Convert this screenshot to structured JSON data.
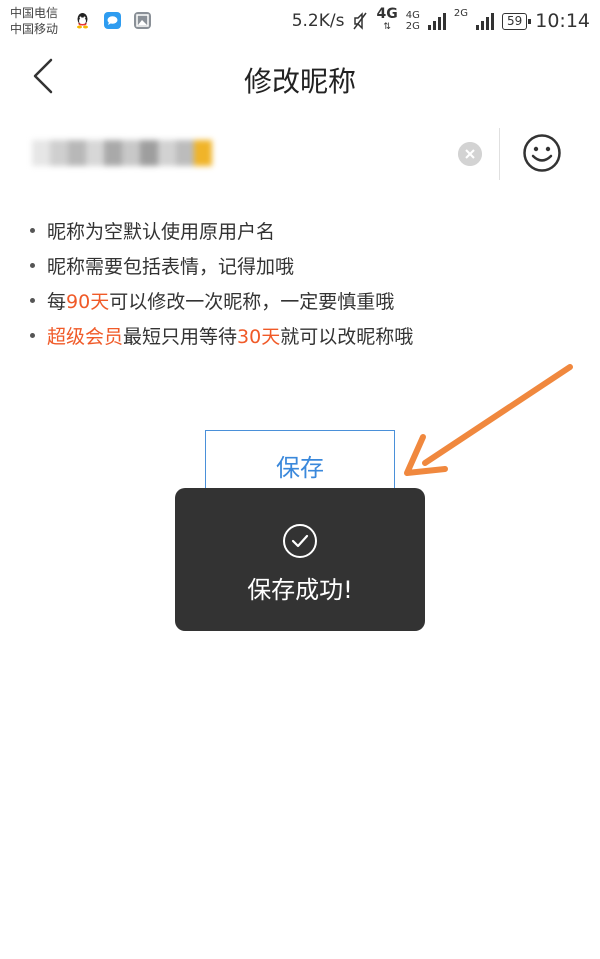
{
  "status_bar": {
    "carrier_1": "中国电信",
    "carrier_2": "中国移动",
    "net_speed": "5.2K/s",
    "network_1": "4G",
    "network_2_top": "4G",
    "network_2_bottom": "2G",
    "network_3": "2G",
    "battery": "59",
    "time": "10:14"
  },
  "header": {
    "title": "修改昵称"
  },
  "nickname": {
    "value": "",
    "placeholder": ""
  },
  "tips": [
    {
      "text": "昵称为空默认使用原用户名"
    },
    {
      "text": "昵称需要包括表情，记得加哦"
    },
    {
      "pre": "每",
      "hl": "90天",
      "post": "可以修改一次昵称，一定要慎重哦"
    },
    {
      "hl1": "超级会员",
      "mid": "最短只用等待",
      "hl2": "30天",
      "post": "就可以改昵称哦"
    }
  ],
  "save_button": {
    "label": "保存"
  },
  "toast": {
    "message": "保存成功!"
  },
  "colors": {
    "highlight": "#f05a28",
    "button_text": "#3a88db",
    "toast_bg": "#333333",
    "annotation_arrow": "#f0883e"
  },
  "icons": {
    "back": "chevron-left-icon",
    "clear": "clear-icon",
    "emoji": "smiley-icon",
    "toast": "check-circle-icon"
  }
}
